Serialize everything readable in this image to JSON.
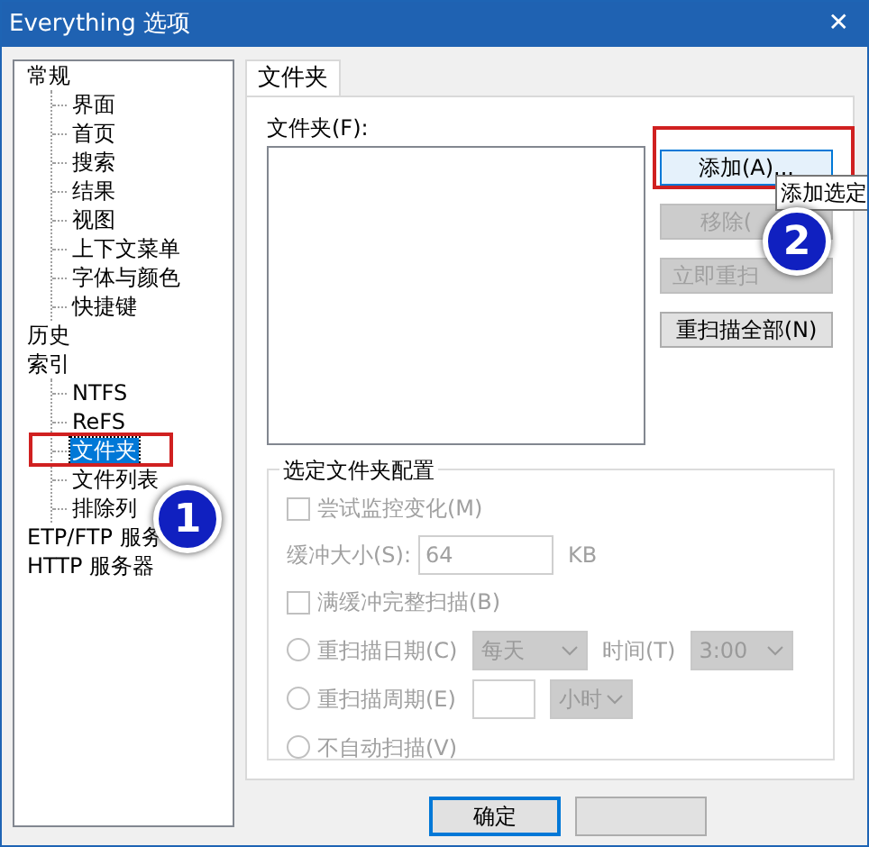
{
  "window": {
    "title": "Everything 选项",
    "close": "✕"
  },
  "sidebar": {
    "items": [
      {
        "label": "常规",
        "selected": false,
        "children": [
          {
            "label": "界面",
            "selected": false
          },
          {
            "label": "首页",
            "selected": false
          },
          {
            "label": "搜索",
            "selected": false
          },
          {
            "label": "结果",
            "selected": false
          },
          {
            "label": "视图",
            "selected": false
          },
          {
            "label": "上下文菜单",
            "selected": false
          },
          {
            "label": "字体与颜色",
            "selected": false
          },
          {
            "label": "快捷键",
            "selected": false
          }
        ]
      },
      {
        "label": "历史",
        "selected": false
      },
      {
        "label": "索引",
        "selected": false,
        "children": [
          {
            "label": "NTFS",
            "selected": false
          },
          {
            "label": "ReFS",
            "selected": false
          },
          {
            "label": "文件夹",
            "selected": true
          },
          {
            "label": "文件列表",
            "selected": false
          },
          {
            "label": "排除列",
            "selected": false
          }
        ]
      },
      {
        "label": "ETP/FTP 服务",
        "selected": false
      },
      {
        "label": "HTTP 服务器",
        "selected": false
      }
    ]
  },
  "tabs": [
    {
      "label": "文件夹",
      "selected": true
    }
  ],
  "folders": {
    "label": "文件夹(F):"
  },
  "buttons": [
    {
      "label": "添加(A)...",
      "disabled": false,
      "focused": true
    },
    {
      "label": "移除(",
      "disabled": true,
      "focused": false
    },
    {
      "label": "立即重扫",
      "disabled": true,
      "focused": false
    },
    {
      "label": "重扫描全部(N)",
      "disabled": false,
      "focused": false
    }
  ],
  "tooltip": "添加选定",
  "group": {
    "title": "选定文件夹配置",
    "rows": [
      {
        "kind": "checkbox",
        "label": "尝试监控变化(M)",
        "checked": false,
        "disabled": true
      },
      {
        "kind": "field",
        "label": "缓冲大小(S):",
        "value": "64",
        "unit": "KB",
        "disabled": true
      },
      {
        "kind": "checkbox",
        "label": "满缓冲完整扫描(B)",
        "checked": false,
        "disabled": true
      },
      {
        "kind": "radio",
        "label": "重扫描日期(C)",
        "selected": false,
        "disabled": true,
        "select1": "每天",
        "label2": "时间(T)",
        "select2": "3:00"
      },
      {
        "kind": "radio",
        "label": "重扫描周期(E)",
        "selected": false,
        "disabled": true,
        "value": "",
        "select1": "小时"
      },
      {
        "kind": "radio",
        "label": "不自动扫描(V)",
        "selected": false,
        "disabled": true
      }
    ]
  },
  "footer": {
    "ok": "确定"
  },
  "annotations": [
    {
      "number": "1",
      "color": "#1020c0"
    },
    {
      "number": "2",
      "color": "#1020c0"
    }
  ]
}
